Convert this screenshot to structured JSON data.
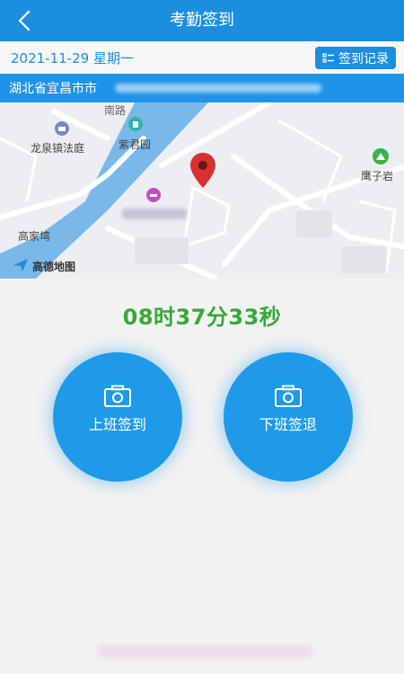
{
  "header": {
    "title": "考勤签到",
    "back_icon": "chevron-left-icon"
  },
  "datebar": {
    "date": "2021-11-29 星期一",
    "record_label": "签到记录",
    "record_icon": "list-icon"
  },
  "location": {
    "address": "湖北省宜昌市市"
  },
  "map": {
    "labels": {
      "court": "龙泉镇法庭",
      "garden": "紫君园",
      "eagle_rock": "鹰子岩",
      "village": "高家塆",
      "road": "南路",
      "brand": "高德地图"
    },
    "pin_icon": "location-pin-icon"
  },
  "clock": {
    "time": "08时37分33秒",
    "color": "#36a936"
  },
  "actions": {
    "check_in_label": "上班签到",
    "check_out_label": "下班签退",
    "camera_icon": "camera-icon"
  },
  "theme": {
    "primary": "#1a8fe0",
    "background": "#f2f2f2"
  }
}
